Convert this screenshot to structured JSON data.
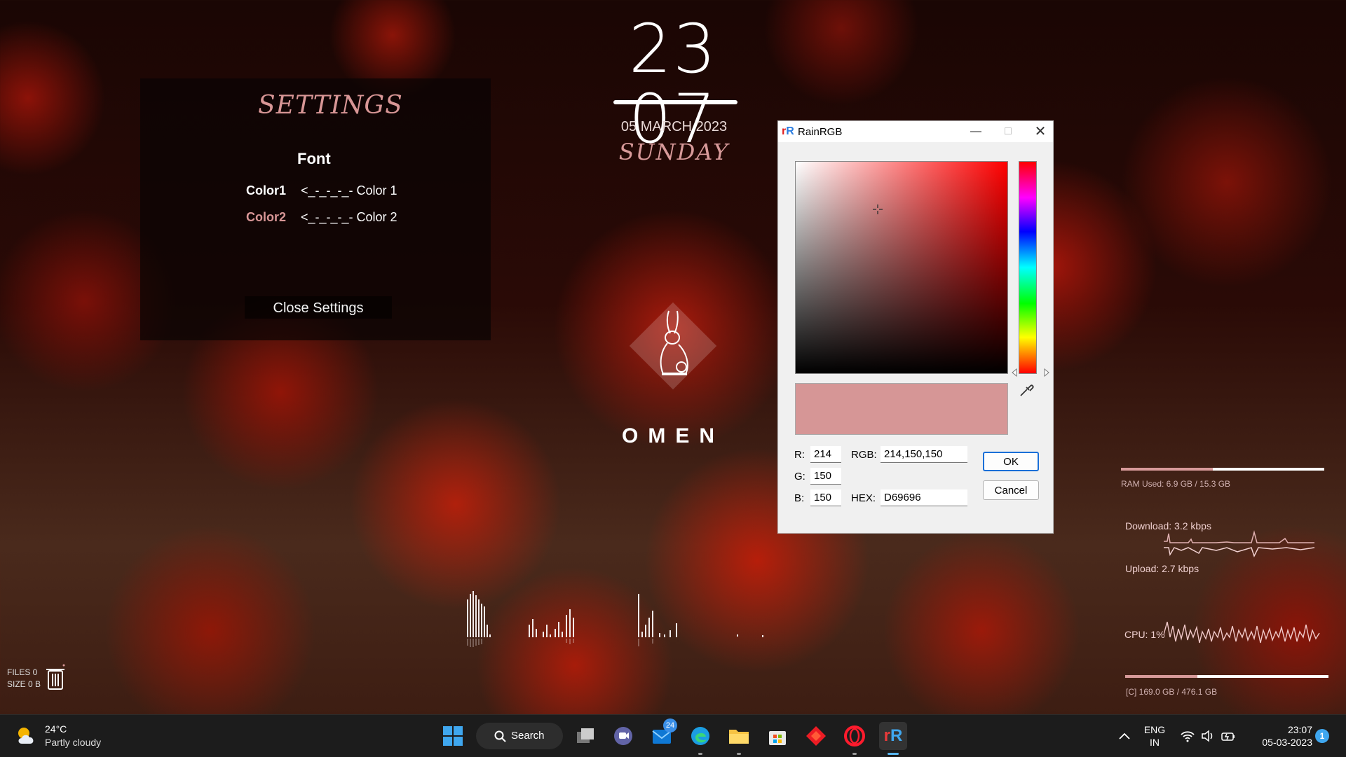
{
  "clock": {
    "time": "23 07",
    "date": "05 MARCH 2023",
    "day": "SUNDAY"
  },
  "settings": {
    "title": "SETTINGS",
    "section": "Font",
    "rows": [
      {
        "key": "Color1",
        "value": "<_-_-_-_- Color 1"
      },
      {
        "key": "Color2",
        "value": "<_-_-_-_- Color 2"
      }
    ],
    "close_label": "Close Settings"
  },
  "logo": {
    "text": "OMEN"
  },
  "dialog": {
    "title": "RainRGB",
    "icon_letters": "rR",
    "r_label": "R:",
    "r_value": "214",
    "g_label": "G:",
    "g_value": "150",
    "b_label": "B:",
    "b_value": "150",
    "rgb_label": "RGB:",
    "rgb_value": "214,150,150",
    "hex_label": "HEX:",
    "hex_value": "D69696",
    "ok_label": "OK",
    "cancel_label": "Cancel",
    "preview_color": "#d69696"
  },
  "monitor": {
    "ram_text": "RAM Used: 6.9 GB / 15.3 GB",
    "ram_fraction": 0.45,
    "download_text": "Download: 3.2 kbps",
    "upload_text": "Upload: 2.7 kbps",
    "cpu_text": "CPU: 1%",
    "disk_text": "[C] 169.0 GB / 476.1 GB",
    "disk_fraction": 0.355
  },
  "recycle": {
    "files": "FILES 0",
    "size": "SIZE 0 B"
  },
  "taskbar": {
    "temp": "24°C",
    "weather": "Partly cloudy",
    "search_label": "Search",
    "badge_count": "24",
    "lang_top": "ENG",
    "lang_bottom": "IN",
    "time": "23:07",
    "date": "05-03-2023",
    "notification_count": "1"
  },
  "colors": {
    "accent": "#d89696",
    "ok_border": "#1a6fd8",
    "active_indicator": "#58b6f0"
  }
}
